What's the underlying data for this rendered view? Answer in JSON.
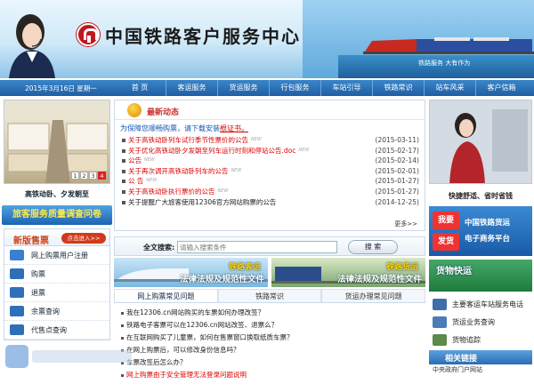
{
  "header": {
    "site_title": "中国铁路客户服务中心",
    "slogan": "铁路服务 大有作为"
  },
  "nav": {
    "date": "2015年3月16日 星期一",
    "items": [
      "首 页",
      "客运服务",
      "货运服务",
      "行包服务",
      "车站引导",
      "铁路常识",
      "站车风采",
      "客户信箱"
    ]
  },
  "left": {
    "pager": [
      "1",
      "2",
      "3",
      "4"
    ],
    "pager_active": 3,
    "caption": "高铁动卧、夕发朝至",
    "survey_label": "旅客服务质量调查问卷",
    "tickets_title": "新版售票",
    "tickets_more": "点击进入>>",
    "menu": [
      {
        "label": "网上购票用户注册",
        "icon": "user-register-icon"
      },
      {
        "label": "购票",
        "icon": "ticket-buy-icon"
      },
      {
        "label": "退票",
        "icon": "ticket-refund-icon"
      },
      {
        "label": "余票查询",
        "icon": "ticket-remaining-icon"
      },
      {
        "label": "代售点查询",
        "icon": "agency-icon"
      }
    ]
  },
  "news": {
    "title": "最新动态",
    "notice_text": "为保障您顺畅购票，请下载安装",
    "notice_link": "根证书。",
    "items": [
      {
        "text": "关于高铁动卧列车试行季节性票价的公告",
        "date": "(2015-03-11)",
        "red": true,
        "new": true
      },
      {
        "text": "关于优化高铁动卧夕发朝至列车运行时刻和停站公告.doc",
        "date": "(2015-02-17)",
        "red": true,
        "new": true
      },
      {
        "text": "公告",
        "date": "(2015-02-14)",
        "red": true,
        "new": true
      },
      {
        "text": "关于再次调开高铁动卧列车的公告",
        "date": "(2015-02-01)",
        "red": true,
        "new": true
      },
      {
        "text": "公 告",
        "date": "(2015-01-27)",
        "red": true,
        "new": true
      },
      {
        "text": "关于高铁动卧执行票价的公告",
        "date": "(2015-01-27)",
        "red": true,
        "new": true
      },
      {
        "text": "关于提醒广大旅客使用12306官方网站购票的公告",
        "date": "(2014-12-25)",
        "red": false,
        "new": false
      }
    ],
    "more": "更多>>"
  },
  "search": {
    "label": "全文搜索:",
    "placeholder": "请输入搜索条件",
    "button": "搜 索"
  },
  "banners": [
    {
      "title": "铁路客运",
      "subtitle": "法律法规及规范性文件"
    },
    {
      "title": "铁路货运",
      "subtitle": "法律法规及规范性文件"
    }
  ],
  "faq": {
    "tabs": [
      "网上购票常见问题",
      "铁路常识",
      "货运办理常见问题"
    ],
    "active_tab": 0,
    "items": [
      {
        "text": "我在12306.cn网站购买的车票如何办理改签？",
        "red": false
      },
      {
        "text": "铁路电子客票可以在12306.cn网站改签、退票么？",
        "red": false
      },
      {
        "text": "在互联网购买了儿童票，如何在售票窗口换取纸质车票？",
        "red": false
      },
      {
        "text": "在网上购票后，可以修改身份信息吗？",
        "red": false
      },
      {
        "text": "车票改签后怎么办？",
        "red": false
      },
      {
        "text": "网上购票由于安全管理无法登录问题说明",
        "red": true
      }
    ]
  },
  "right": {
    "caption": "快捷舒适、省时省钱",
    "promo_badges": [
      "我要",
      "发货"
    ],
    "promo_lines": [
      "中国铁路货运",
      "电子商务平台"
    ],
    "express_title": "货物快运",
    "list": [
      {
        "label": "主要客运车站服务电话",
        "icon": "phone-icon"
      },
      {
        "label": "货运业务查询",
        "icon": "freight-query-icon"
      },
      {
        "label": "货物追踪",
        "icon": "tracking-icon"
      }
    ],
    "related_title": "相关链接",
    "related_link": "中央政府门户网站"
  },
  "colors": {
    "nav_blue": "#1f5ea4",
    "news_red": "#dd0000",
    "brand_red": "#c0161d"
  }
}
